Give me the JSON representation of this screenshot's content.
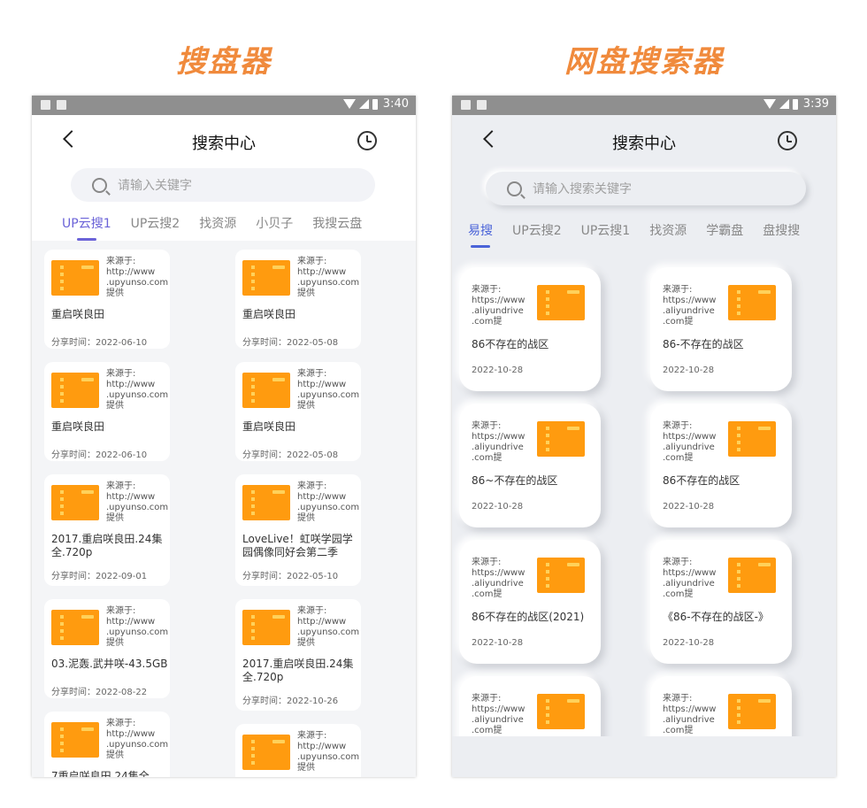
{
  "headings": {
    "left": "搜盘器",
    "right": "网盘搜索器"
  },
  "left_phone": {
    "status_time": "3:40",
    "title": "搜索中心",
    "search_placeholder": "请输入关键字",
    "tabs": [
      {
        "label": "UP云搜1",
        "active": true
      },
      {
        "label": "UP云搜2"
      },
      {
        "label": "找资源"
      },
      {
        "label": "小贝子"
      },
      {
        "label": "我搜云盘"
      }
    ],
    "cards": [
      {
        "source": "来源于:\nhttp://www\n.upyunso.com\n提供",
        "name": "重启咲良田",
        "date": "分享时间：2022-06-10"
      },
      {
        "source": "来源于:\nhttp://www\n.upyunso.com\n提供",
        "name": "重启咲良田",
        "date": "分享时间：2022-05-08"
      },
      {
        "source": "来源于:\nhttp://www\n.upyunso.com\n提供",
        "name": "重启咲良田",
        "date": "分享时间：2022-06-10"
      },
      {
        "source": "来源于:\nhttp://www\n.upyunso.com\n提供",
        "name": "重启咲良田",
        "date": "分享时间：2022-05-08"
      },
      {
        "source": "来源于:\nhttp://www\n.upyunso.com\n提供",
        "name": "2017.重启咲良田.24集全.720p",
        "date": "分享时间：2022-09-01"
      },
      {
        "source": "来源于:\nhttp://www\n.upyunso.com\n提供",
        "name": "LoveLive！虹咲学园学园偶像同好会第二季",
        "date": "分享时间：2022-05-10"
      },
      {
        "source": "来源于:\nhttp://www\n.upyunso.com\n提供",
        "name": "03.泥轰.武井咲-43.5GB",
        "date": "分享时间：2022-08-22"
      },
      {
        "source": "来源于:\nhttp://www\n.upyunso.com\n提供",
        "name": "2017.重启咲良田.24集全.720p",
        "date": "分享时间：2022-10-26"
      },
      {
        "source": "来源于:\nhttp://www\n.upyunso.com\n提供",
        "name": "7重启咲良田.24集全",
        "date": ""
      },
      {
        "source": "来源于:\nhttp://www\n.upyunso.com\n提供",
        "name": "",
        "date": ""
      }
    ]
  },
  "right_phone": {
    "status_time": "3:39",
    "title": "搜索中心",
    "search_placeholder": "请输入搜索关键字",
    "tabs": [
      {
        "label": "易搜",
        "active": true
      },
      {
        "label": "UP云搜2"
      },
      {
        "label": "UP云搜1"
      },
      {
        "label": "找资源"
      },
      {
        "label": "学霸盘"
      },
      {
        "label": "盘搜搜"
      }
    ],
    "cards": [
      {
        "source": "来源于:\nhttps://www\n.aliyundrive\n.com提",
        "name": "86不存在的战区",
        "date": "2022-10-28"
      },
      {
        "source": "来源于:\nhttps://www\n.aliyundrive\n.com提",
        "name": "86-不存在的战区",
        "date": "2022-10-28"
      },
      {
        "source": "来源于:\nhttps://www\n.aliyundrive\n.com提",
        "name": "86~不存在的战区",
        "date": "2022-10-28"
      },
      {
        "source": "来源于:\nhttps://www\n.aliyundrive\n.com提",
        "name": "86不存在的战区",
        "date": "2022-10-28"
      },
      {
        "source": "来源于:\nhttps://www\n.aliyundrive\n.com提",
        "name": "86不存在的战区(2021)",
        "date": "2022-10-28"
      },
      {
        "source": "来源于:\nhttps://www\n.aliyundrive\n.com提",
        "name": "《86-不存在的战区-》",
        "date": "2022-10-28"
      },
      {
        "source": "来源于:\nhttps://www\n.aliyundrive\n.com提",
        "name": "",
        "date": ""
      },
      {
        "source": "来源于:\nhttps://www\n.aliyundrive\n.com提",
        "name": "",
        "date": ""
      }
    ]
  },
  "colors": {
    "heading": "#f08a3c",
    "thumbnail": "#ff9b0f",
    "active_tab_left": "#6b63d8",
    "active_tab_right": "#4a63d8"
  }
}
